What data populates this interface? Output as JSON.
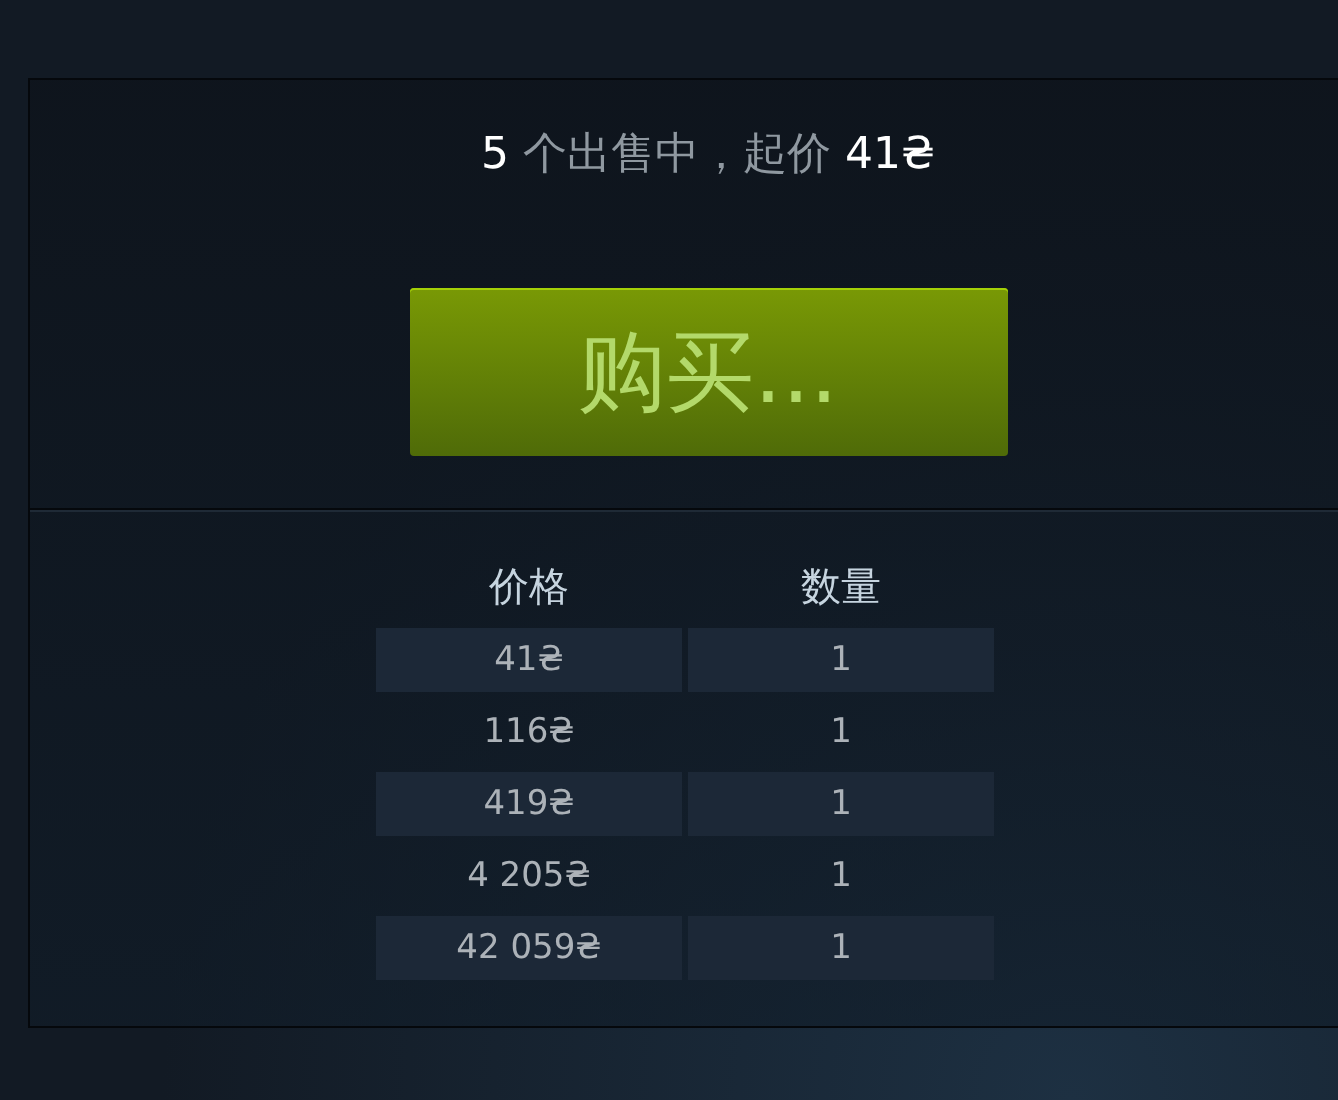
{
  "summary": {
    "count": "5",
    "label": "个出售中，起价",
    "price": "41₴"
  },
  "buy_button": {
    "label": "购买..."
  },
  "table": {
    "columns": [
      "价格",
      "数量"
    ],
    "rows": [
      {
        "price": "41₴",
        "quantity": "1",
        "shaded": true
      },
      {
        "price": "116₴",
        "quantity": "1",
        "shaded": false
      },
      {
        "price": "419₴",
        "quantity": "1",
        "shaded": true
      },
      {
        "price": "4 205₴",
        "quantity": "1",
        "shaded": false
      },
      {
        "price": "42 059₴",
        "quantity": "1",
        "shaded": true
      }
    ]
  }
}
